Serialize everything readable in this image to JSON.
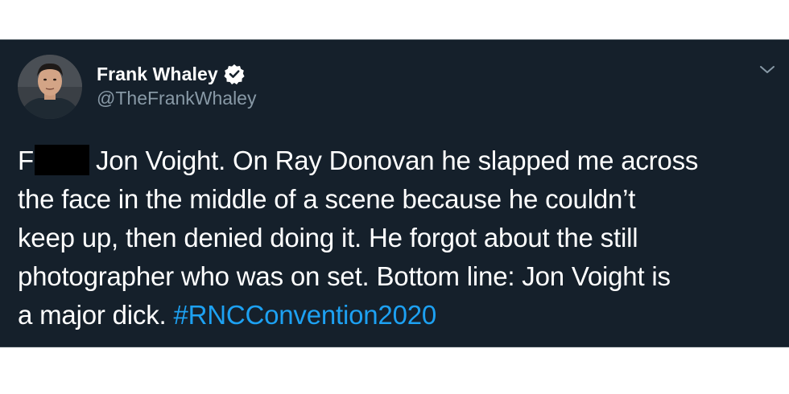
{
  "tweet": {
    "author": {
      "display_name": "Frank Whaley",
      "handle": "@TheFrankWhaley",
      "verified_icon": "verified-badge-icon",
      "avatar": "author-avatar"
    },
    "menu_icon": "chevron-down-icon",
    "text": {
      "line1_start": "F",
      "line1_rest": "Jon Voight. On Ray Donovan he slapped me across",
      "line2": "the face in the middle of a scene because he couldn’t",
      "line3": "keep up, then denied doing it. He forgot about the still",
      "line4": "photographer who was on set. Bottom line: Jon Voight is",
      "line5_start": "a major dick.",
      "hashtag": "#RNCConvention2020"
    }
  },
  "colors": {
    "card_background": "#15202b",
    "text_primary": "#ffffff",
    "text_secondary": "#8899a6",
    "link": "#1da1f2",
    "redaction": "#000000"
  }
}
